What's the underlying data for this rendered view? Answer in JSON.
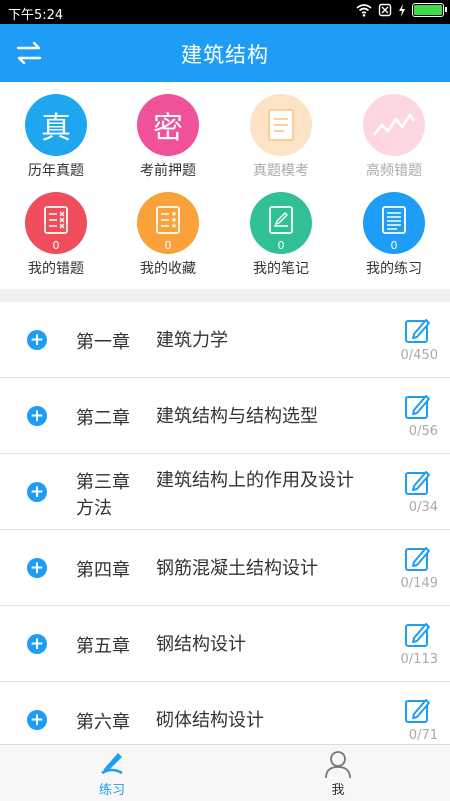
{
  "status_bar": {
    "time": "下午5:24"
  },
  "header": {
    "title": "建筑结构"
  },
  "grid": [
    {
      "label": "历年真题",
      "glyph": "真",
      "color": "#1ea6ef",
      "faded": false,
      "icon": "text"
    },
    {
      "label": "考前押题",
      "glyph": "密",
      "color": "#f0529a",
      "faded": false,
      "icon": "text"
    },
    {
      "label": "真题模考",
      "glyph": "",
      "color": "#fde3c5",
      "faded": true,
      "icon": "document-icon"
    },
    {
      "label": "高频错题",
      "glyph": "",
      "color": "#fdd7df",
      "faded": true,
      "icon": "trend-line-icon"
    },
    {
      "label": "我的错题",
      "count": "0",
      "color": "#ef4d5b",
      "faded": false,
      "icon": "wrong-list-icon"
    },
    {
      "label": "我的收藏",
      "count": "0",
      "color": "#f9a23a",
      "faded": false,
      "icon": "star-list-icon"
    },
    {
      "label": "我的笔记",
      "count": "0",
      "color": "#31c096",
      "faded": false,
      "icon": "note-icon"
    },
    {
      "label": "我的练习",
      "count": "0",
      "color": "#1e9df7",
      "faded": false,
      "icon": "practice-list-icon"
    }
  ],
  "chapters": [
    {
      "chapter": "第一章",
      "title": "建筑力学",
      "count": "0/450"
    },
    {
      "chapter": "第二章",
      "title": "建筑结构与结构选型",
      "count": "0/56"
    },
    {
      "chapter": "第三章",
      "title": "建筑结构上的作用及设计",
      "title_cont": "方法",
      "count": "0/34"
    },
    {
      "chapter": "第四章",
      "title": "钢筋混凝土结构设计",
      "count": "0/149"
    },
    {
      "chapter": "第五章",
      "title": "钢结构设计",
      "count": "0/113"
    },
    {
      "chapter": "第六章",
      "title": "砌体结构设计",
      "count": "0/71"
    }
  ],
  "bottom_nav": {
    "practice": "练习",
    "me": "我"
  },
  "colors": {
    "primary": "#1e9df7"
  }
}
